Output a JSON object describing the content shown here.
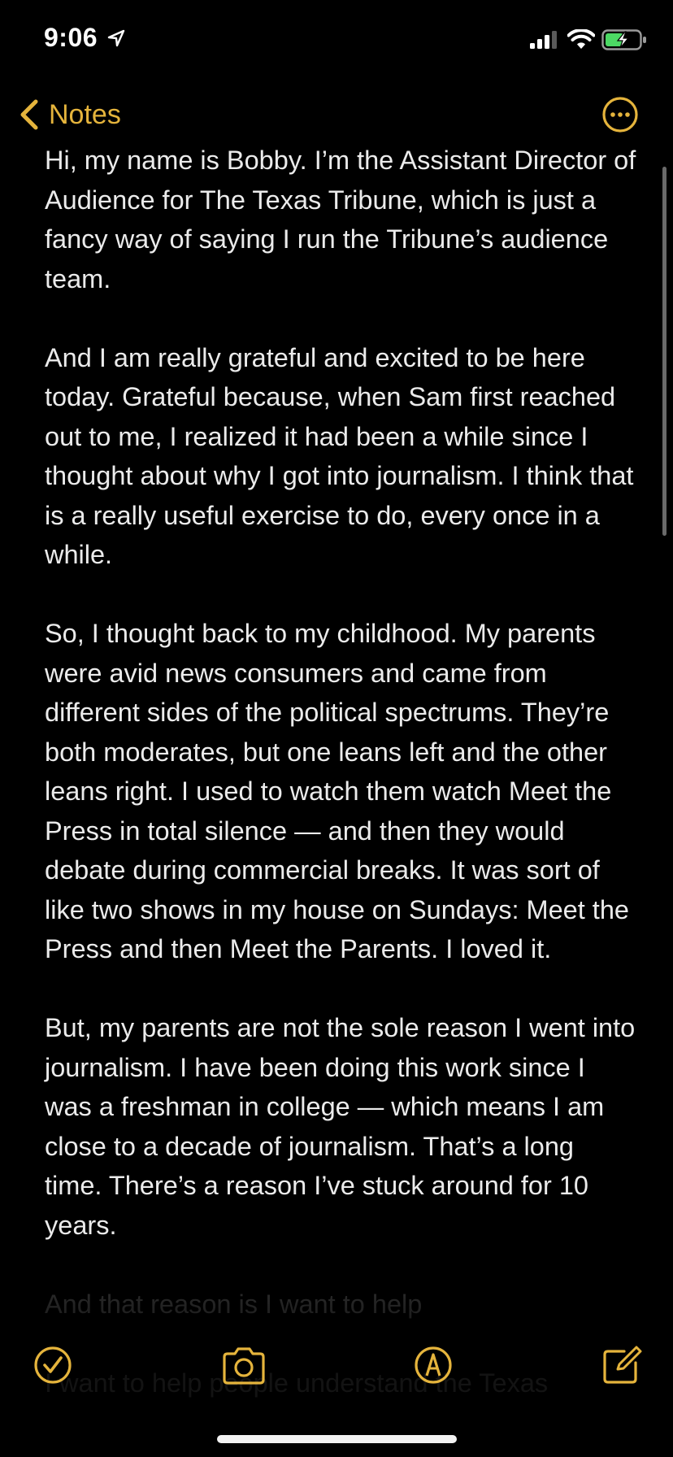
{
  "status_bar": {
    "time": "9:06"
  },
  "nav": {
    "back_label": "Notes"
  },
  "note": {
    "paragraphs": [
      "Hi, my name is Bobby. I’m the Assistant Director of Audience for The Texas Tribune, which is just a fancy way of saying I run the Tribune’s audience team.",
      "And I am really grateful and excited to be here today. Grateful because, when Sam first reached out to me, I realized it had been a while since I thought about why I got into journalism. I think that is a really useful exercise to do, every once in a while.",
      "So, I thought back to my childhood. My parents were avid news consumers and came from different sides of the political spectrums. They’re both moderates, but one leans left and the other leans right. I used to watch them watch Meet the Press in total silence — and then they would debate during commercial breaks. It was sort of like two shows in my house on Sundays: Meet the Press and then Meet the Parents. I loved it.",
      "But, my parents are not the sole reason I went into journalism. I have been doing this work since I was a freshman in college — which means I am close to a decade of journalism. That’s a long time. There’s a reason I’ve stuck around for 10 years.",
      "And that reason is I want to help",
      "I want to help people understand the Texas"
    ]
  },
  "colors": {
    "accent": "#E5B43C",
    "background": "#000000",
    "text": "#EBEBEB"
  },
  "toolbar": {
    "icons": [
      "checklist-icon",
      "camera-icon",
      "markup-icon",
      "compose-icon"
    ]
  }
}
